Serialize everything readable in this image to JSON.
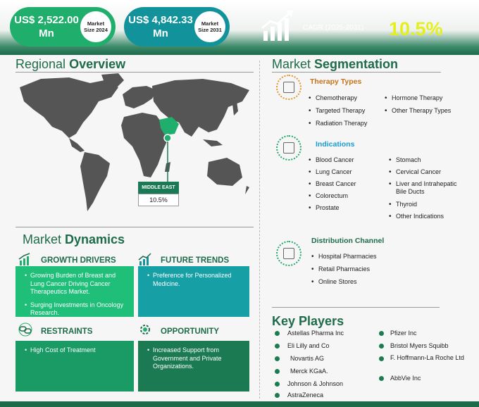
{
  "header": {
    "market_2024": {
      "value_line1": "US$ 2,522.00",
      "value_line2": "Mn",
      "label_line1": "Market",
      "label_line2": "Size 2024",
      "color": "#1fae6b"
    },
    "market_2031": {
      "value_line1": "US$ 4,842.33",
      "value_line2": "Mn",
      "label_line1": "Market",
      "label_line2": "Size 2031",
      "color": "#12929a"
    },
    "cagr_label": "CAGR (2025-2031)",
    "cagr_value": "10.5%",
    "cagr_icon": "growth-chart-icon"
  },
  "regional": {
    "title_light": "Regional ",
    "title_bold": "Overview",
    "region_label": "MIDDLE EAST",
    "region_value": "10.5%"
  },
  "dynamics": {
    "title_light": "Market ",
    "title_bold": "Dynamics",
    "growth_drivers": {
      "title": "GROWTH DRIVERS",
      "icon": "growth-chart-icon",
      "items": [
        "Growing Burden of Breast and Lung Cancer Driving Cancer Therapeutics Market.",
        "Surging Investments in Oncology Research."
      ]
    },
    "future_trends": {
      "title": "FUTURE TRENDS",
      "icon": "trend-chart-icon",
      "items": [
        "Preference for Personalized Medicine."
      ]
    },
    "restraints": {
      "title": "RESTRAINTS",
      "icon": "chain-link-icon",
      "items": [
        "High Cost of Treatment"
      ]
    },
    "opportunity": {
      "title": "OPPORTUNITY",
      "icon": "gear-icon",
      "items": [
        "Increased Support from Government and Private Organizations."
      ]
    }
  },
  "segmentation": {
    "title_light": "Market ",
    "title_bold": "Segmentation",
    "therapy": {
      "title": "Therapy Types",
      "col1": [
        "Chemotherapy",
        "Targeted Therapy",
        "Radiation Therapy"
      ],
      "col2": [
        "Hormone Therapy",
        "Other Therapy Types"
      ]
    },
    "indications": {
      "title": "Indications",
      "col1": [
        "Blood Cancer",
        "Lung Cancer",
        "Breast Cancer",
        "Colorectum",
        "Prostate"
      ],
      "col2": [
        "Stomach",
        "Cervical Cancer",
        "Liver and Intrahepatic Bile Ducts",
        "Thyroid",
        "Other Indications"
      ]
    },
    "distribution": {
      "title": "Distribution Channel",
      "col1": [
        "Hospital Pharmacies",
        "Retail Pharmacies",
        "Online Stores"
      ]
    }
  },
  "key_players": {
    "title": "Key Players",
    "col1": [
      "Astellas Pharma Inc",
      "Eli Lilly and Co",
      "Novartis AG",
      "Merck KGaA.",
      "Johnson & Johnson",
      "AstraZeneca"
    ],
    "col2": [
      "Pfizer Inc",
      "Bristol Myers Squibb",
      "F. Hoffmann-La Roche Ltd",
      "AbbVie Inc"
    ]
  },
  "colors": {
    "brand_green": "#1e6b4a",
    "accent_green": "#1fae6b",
    "teal": "#12929a",
    "yellow": "#e6ef1e",
    "orange_title": "#c8741b",
    "blue_title": "#1a9cd0"
  }
}
